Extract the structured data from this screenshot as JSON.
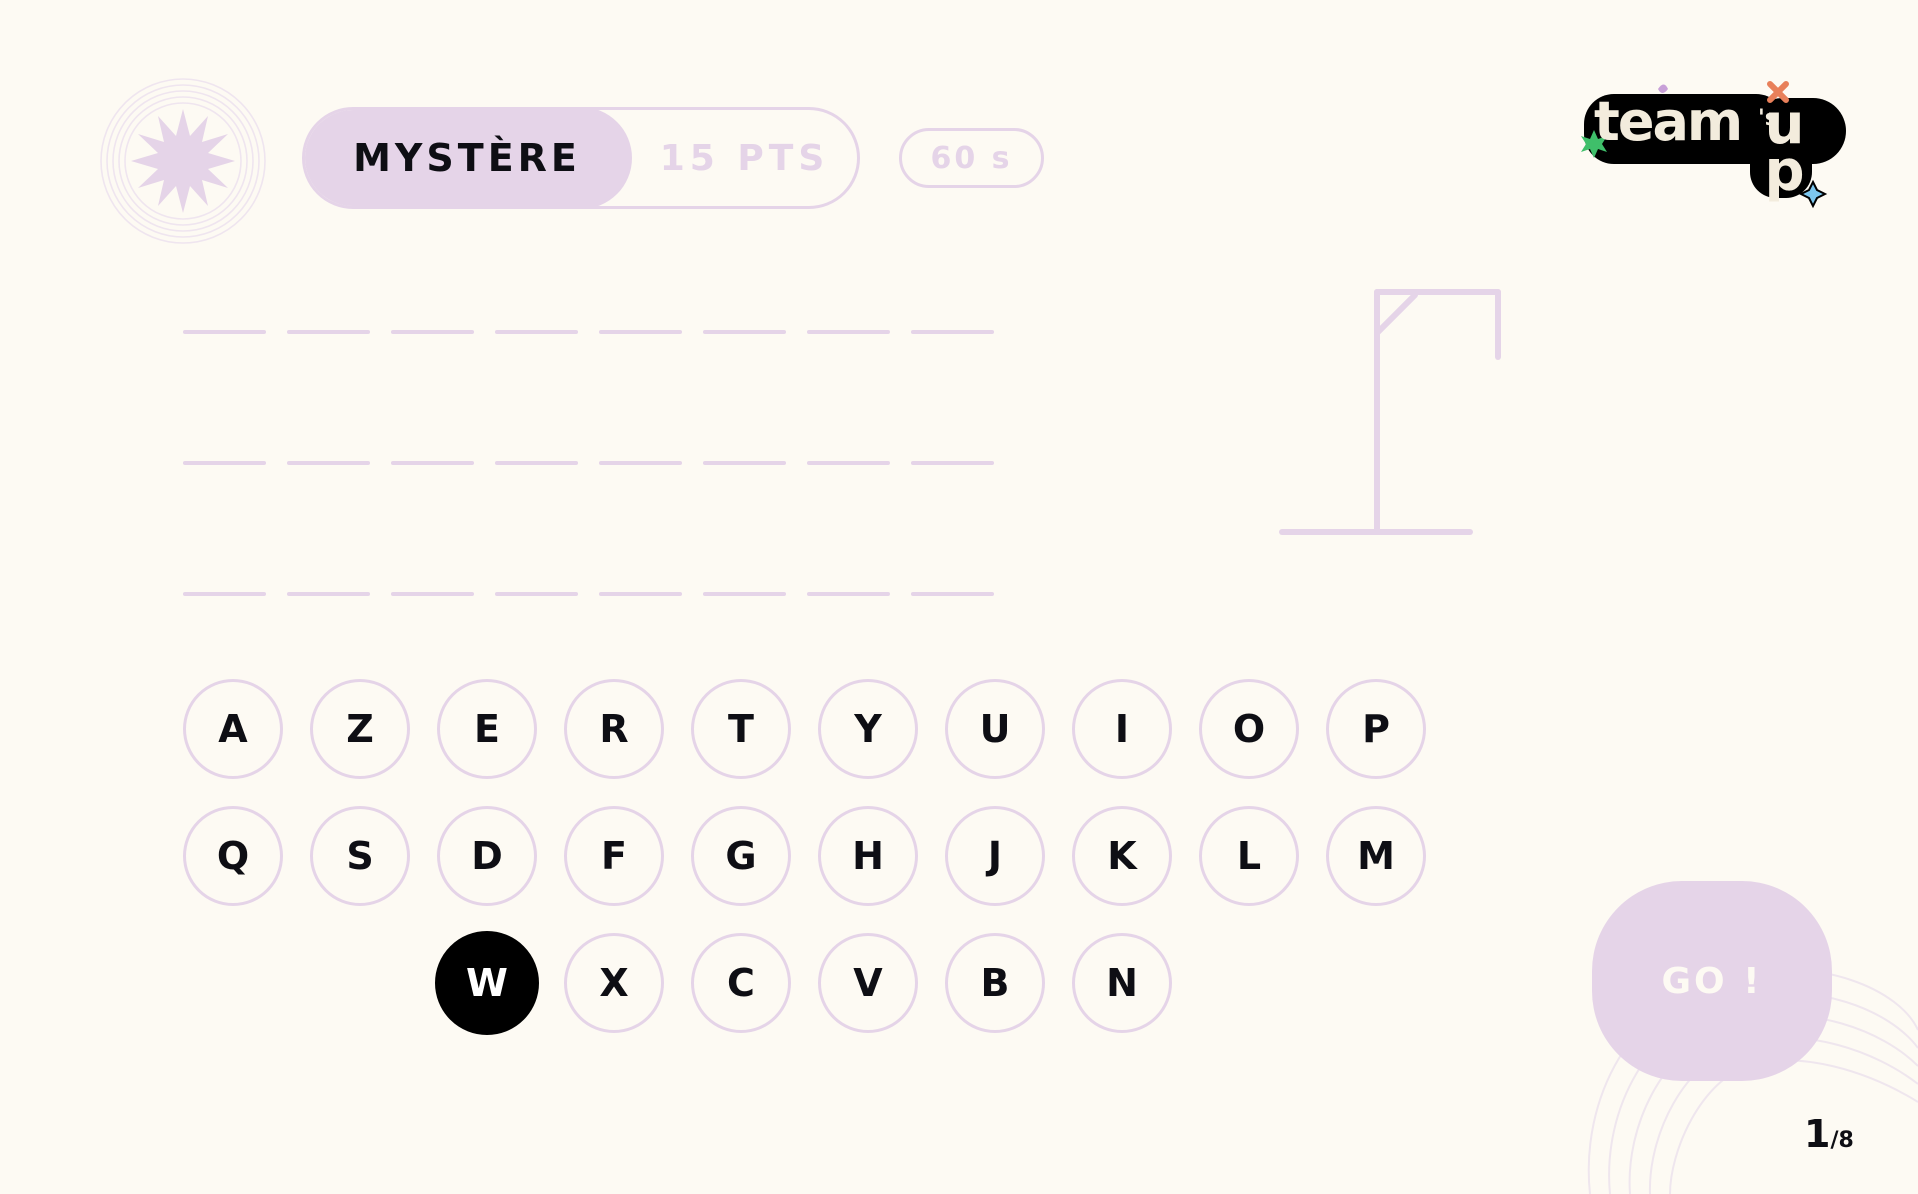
{
  "header": {
    "category_name": "MYSTÈRE",
    "category_points": "15 PTS",
    "timer": "60 s",
    "category_icon": "starburst-icon"
  },
  "logo": {
    "text_main": "team",
    "text_apostrophe_s": "'s",
    "text_up": "up"
  },
  "word": {
    "rows": [
      [
        "",
        "",
        "",
        "",
        "",
        "",
        "",
        ""
      ],
      [
        "",
        "",
        "",
        "",
        "",
        "",
        "",
        ""
      ],
      [
        "",
        "",
        "",
        "",
        "",
        "",
        "",
        ""
      ]
    ]
  },
  "keyboard": {
    "rows": [
      [
        "A",
        "Z",
        "E",
        "R",
        "T",
        "Y",
        "U",
        "I",
        "O",
        "P"
      ],
      [
        "Q",
        "S",
        "D",
        "F",
        "G",
        "H",
        "J",
        "K",
        "L",
        "M"
      ],
      [
        "W",
        "X",
        "C",
        "V",
        "B",
        "N"
      ]
    ],
    "selected": "W"
  },
  "go_button": {
    "label": "GO !"
  },
  "page": {
    "current": "1",
    "total": "/8"
  },
  "colors": {
    "background": "#fdfaf3",
    "accent_lilac": "#e5d4e8",
    "text_dark": "#0e0e14",
    "selected_key": "#000000"
  }
}
